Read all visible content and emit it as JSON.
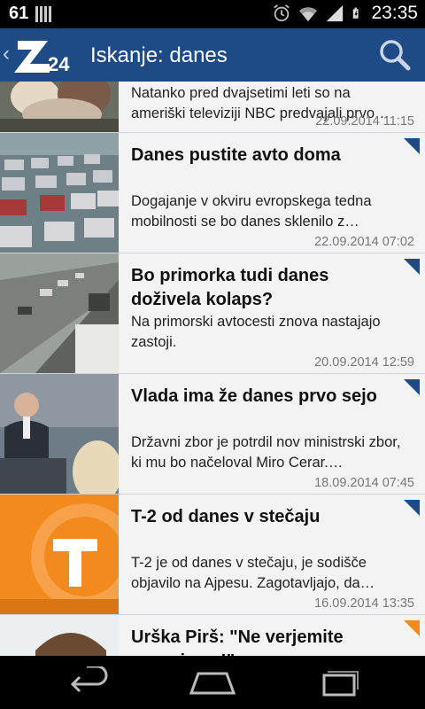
{
  "status_bar": {
    "notification_count": "61",
    "time": "23:35",
    "icons": [
      "alarm-icon",
      "wifi-icon",
      "signal-icon",
      "battery-icon"
    ]
  },
  "action_bar": {
    "logo_text": "Z24",
    "title": "Iskanje: danes",
    "search_icon": "search-icon"
  },
  "articles": [
    {
      "title": "",
      "summary": "Natanko pred dvajsetimi leti so na ameriški televiziji NBC predvajali prvo…",
      "date": "22.09.2014 11:15",
      "corner_color": ""
    },
    {
      "title": "Danes pustite avto doma",
      "summary": "Dogajanje v okviru evropskega tedna mobilnosti se bo danes sklenilo z…",
      "date": "22.09.2014 07:02",
      "corner_color": "#1e4a86"
    },
    {
      "title": "Bo primorka tudi danes doživela kolaps?",
      "summary": "Na primorski avtocesti znova nastajajo zastoji.",
      "date": "20.09.2014 12:59",
      "corner_color": "#1e4a86"
    },
    {
      "title": "Vlada ima že danes prvo sejo",
      "summary": "Državni zbor je potrdil nov ministrski zbor, ki mu bo načeloval Miro Cerar.…",
      "date": "18.09.2014 07:45",
      "corner_color": "#1e4a86"
    },
    {
      "title": "T-2 od danes v stečaju",
      "summary": "T-2 je od danes v stečaju, je sodišče objavilo na Ajpesu. Zagotavljajo, da…",
      "date": "16.09.2014 13:35",
      "corner_color": "#1e4a86"
    },
    {
      "title": "Urška Pirš: \"Ne verjemite govoricam!\"",
      "summary": "",
      "date": "",
      "corner_color": "#f28a1e"
    }
  ],
  "navigation": {
    "back": "back-icon",
    "home": "home-icon",
    "recents": "recents-icon"
  }
}
